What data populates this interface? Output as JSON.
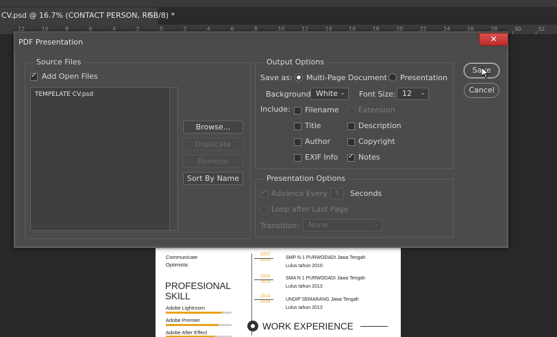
{
  "app": {
    "document_tab": "CV.psd @ 16.7% (CONTACT PERSON, RGB/8) *",
    "tab_close": "✕",
    "ruler_labels": [
      "12",
      "10",
      "8",
      "6",
      "4",
      "2",
      "0",
      "2",
      "4",
      "6",
      "8",
      "10",
      "12",
      "14",
      "16",
      "18",
      "20",
      "22",
      "24",
      "26",
      "28",
      "30",
      "32"
    ]
  },
  "document": {
    "left_items": [
      "Communicate",
      "Optimistic"
    ],
    "skills_title_line1": "PROFESIONAL",
    "skills_title_line2": "SKILL",
    "skills": [
      {
        "name": "Adobe Lightroom",
        "level": 0.85
      },
      {
        "name": "Adobe Premier",
        "level": 0.8
      },
      {
        "name": "Adobe After Effect",
        "level": 0.75
      }
    ],
    "education": [
      {
        "year_start": "2007",
        "year_end": "2010",
        "school": "SMP N 1 PURWODADI Jawa Tengah",
        "note": "Lulus tahun 2010"
      },
      {
        "year_start": "2010",
        "year_end": "2013",
        "school": "SMA N 1 PURWODADI Jawa Tengah",
        "note": "Lulus tahun 2013"
      },
      {
        "year_start": "2013",
        "year_end": "2016",
        "school": "UNDIP SEMARANG Jawa Tengah",
        "note": "Lulus tahun 2013"
      }
    ],
    "work_title": "WORK EXPERIENCE"
  },
  "dialog": {
    "title": "PDF Presentation",
    "close_label": "✕",
    "source": {
      "legend": "Source Files",
      "add_open_files_label": "Add Open Files",
      "add_open_files_checked": true,
      "files": [
        "TEMPELATE CV.psd"
      ],
      "browse_label": "Browse...",
      "duplicate_label": "Duplicate",
      "remove_label": "Remove",
      "sort_label": "Sort By Name"
    },
    "output": {
      "legend": "Output Options",
      "save_as_label": "Save as:",
      "multi_page_label": "Multi-Page Document",
      "presentation_label": "Presentation",
      "selected_mode": "Multi-Page Document",
      "background_label": "Background:",
      "background_value": "White",
      "font_size_label": "Font Size:",
      "font_size_value": "12",
      "include_label": "Include:",
      "include": {
        "filename": {
          "label": "Filename",
          "checked": false
        },
        "extension": {
          "label": "Extension",
          "checked": false,
          "disabled": true
        },
        "title": {
          "label": "Title",
          "checked": false
        },
        "description": {
          "label": "Description",
          "checked": false
        },
        "author": {
          "label": "Author",
          "checked": false
        },
        "copyright": {
          "label": "Copyright",
          "checked": false
        },
        "exif": {
          "label": "EXIF Info",
          "checked": false
        },
        "notes": {
          "label": "Notes",
          "checked": true
        }
      }
    },
    "presentation": {
      "legend": "Presentation Options",
      "advance_label": "Advance Every",
      "advance_value": "5",
      "seconds_label": "Seconds",
      "loop_label": "Loop after Last Page",
      "transition_label": "Transition:",
      "transition_value": "None"
    },
    "save_label": "Save",
    "cancel_label": "Cancel"
  }
}
